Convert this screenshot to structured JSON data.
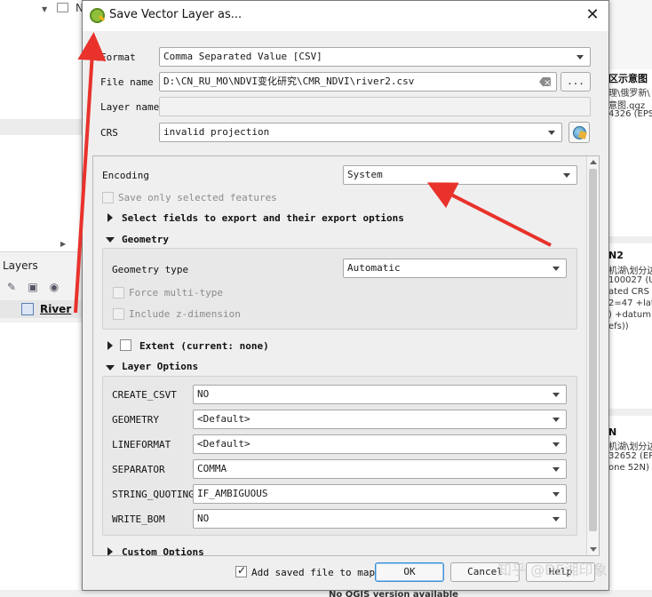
{
  "dialog": {
    "title": "Save Vector Layer as...",
    "close_icon": "close-icon",
    "format_label": "Format",
    "format_value": "Comma Separated Value [CSV]",
    "filename_label": "File name",
    "filename_value": "D:\\CN_RU_MO\\NDVI变化研究\\CMR_NDVI\\river2.csv",
    "browse_label": "...",
    "layername_label": "Layer name",
    "layername_value": "",
    "crs_label": "CRS",
    "crs_value": "invalid projection"
  },
  "options": {
    "encoding_label": "Encoding",
    "encoding_value": "System",
    "save_selected_label": "Save only selected features",
    "select_fields_label": "Select fields to export and their export options",
    "geometry_section": "Geometry",
    "geometry_type_label": "Geometry type",
    "geometry_type_value": "Automatic",
    "force_multi_label": "Force multi-type",
    "include_z_label": "Include z-dimension",
    "extent_label": "Extent (current: none)",
    "layer_options_section": "Layer Options",
    "layer_options": [
      {
        "key": "CREATE_CSVT",
        "value": "NO"
      },
      {
        "key": "GEOMETRY",
        "value": "<Default>"
      },
      {
        "key": "LINEFORMAT",
        "value": "<Default>"
      },
      {
        "key": "SEPARATOR",
        "value": "COMMA"
      },
      {
        "key": "STRING_QUOTING",
        "value": "IF_AMBIGUOUS"
      },
      {
        "key": "WRITE_BOM",
        "value": "NO"
      }
    ],
    "custom_options_section": "Custom Options"
  },
  "footer": {
    "add_saved_label": "Add saved file to map",
    "add_saved_checked": true,
    "ok_label": "OK",
    "cancel_label": "Cancel",
    "help_label": "Help"
  },
  "background": {
    "tree_label": "N",
    "layers_title": "Layers",
    "river_label": "River",
    "right_texts": [
      "区示意图",
      "理\\俄罗新\\",
      "意图.qgz",
      "4326 (EPS",
      "N2",
      "机湖\\划分边",
      "100027 (U",
      "ated CRS",
      "2=47 +lat",
      ") +datum=",
      "efs))",
      "N",
      "机湖\\划分边",
      "32652 (EPS",
      "one 52N)"
    ],
    "bottom_text": "No QGIS version available"
  },
  "watermark": "知乎 @DE湘印象",
  "colors": {
    "arrow": "#e8322b",
    "ok_focus": "#3a8fd6"
  }
}
